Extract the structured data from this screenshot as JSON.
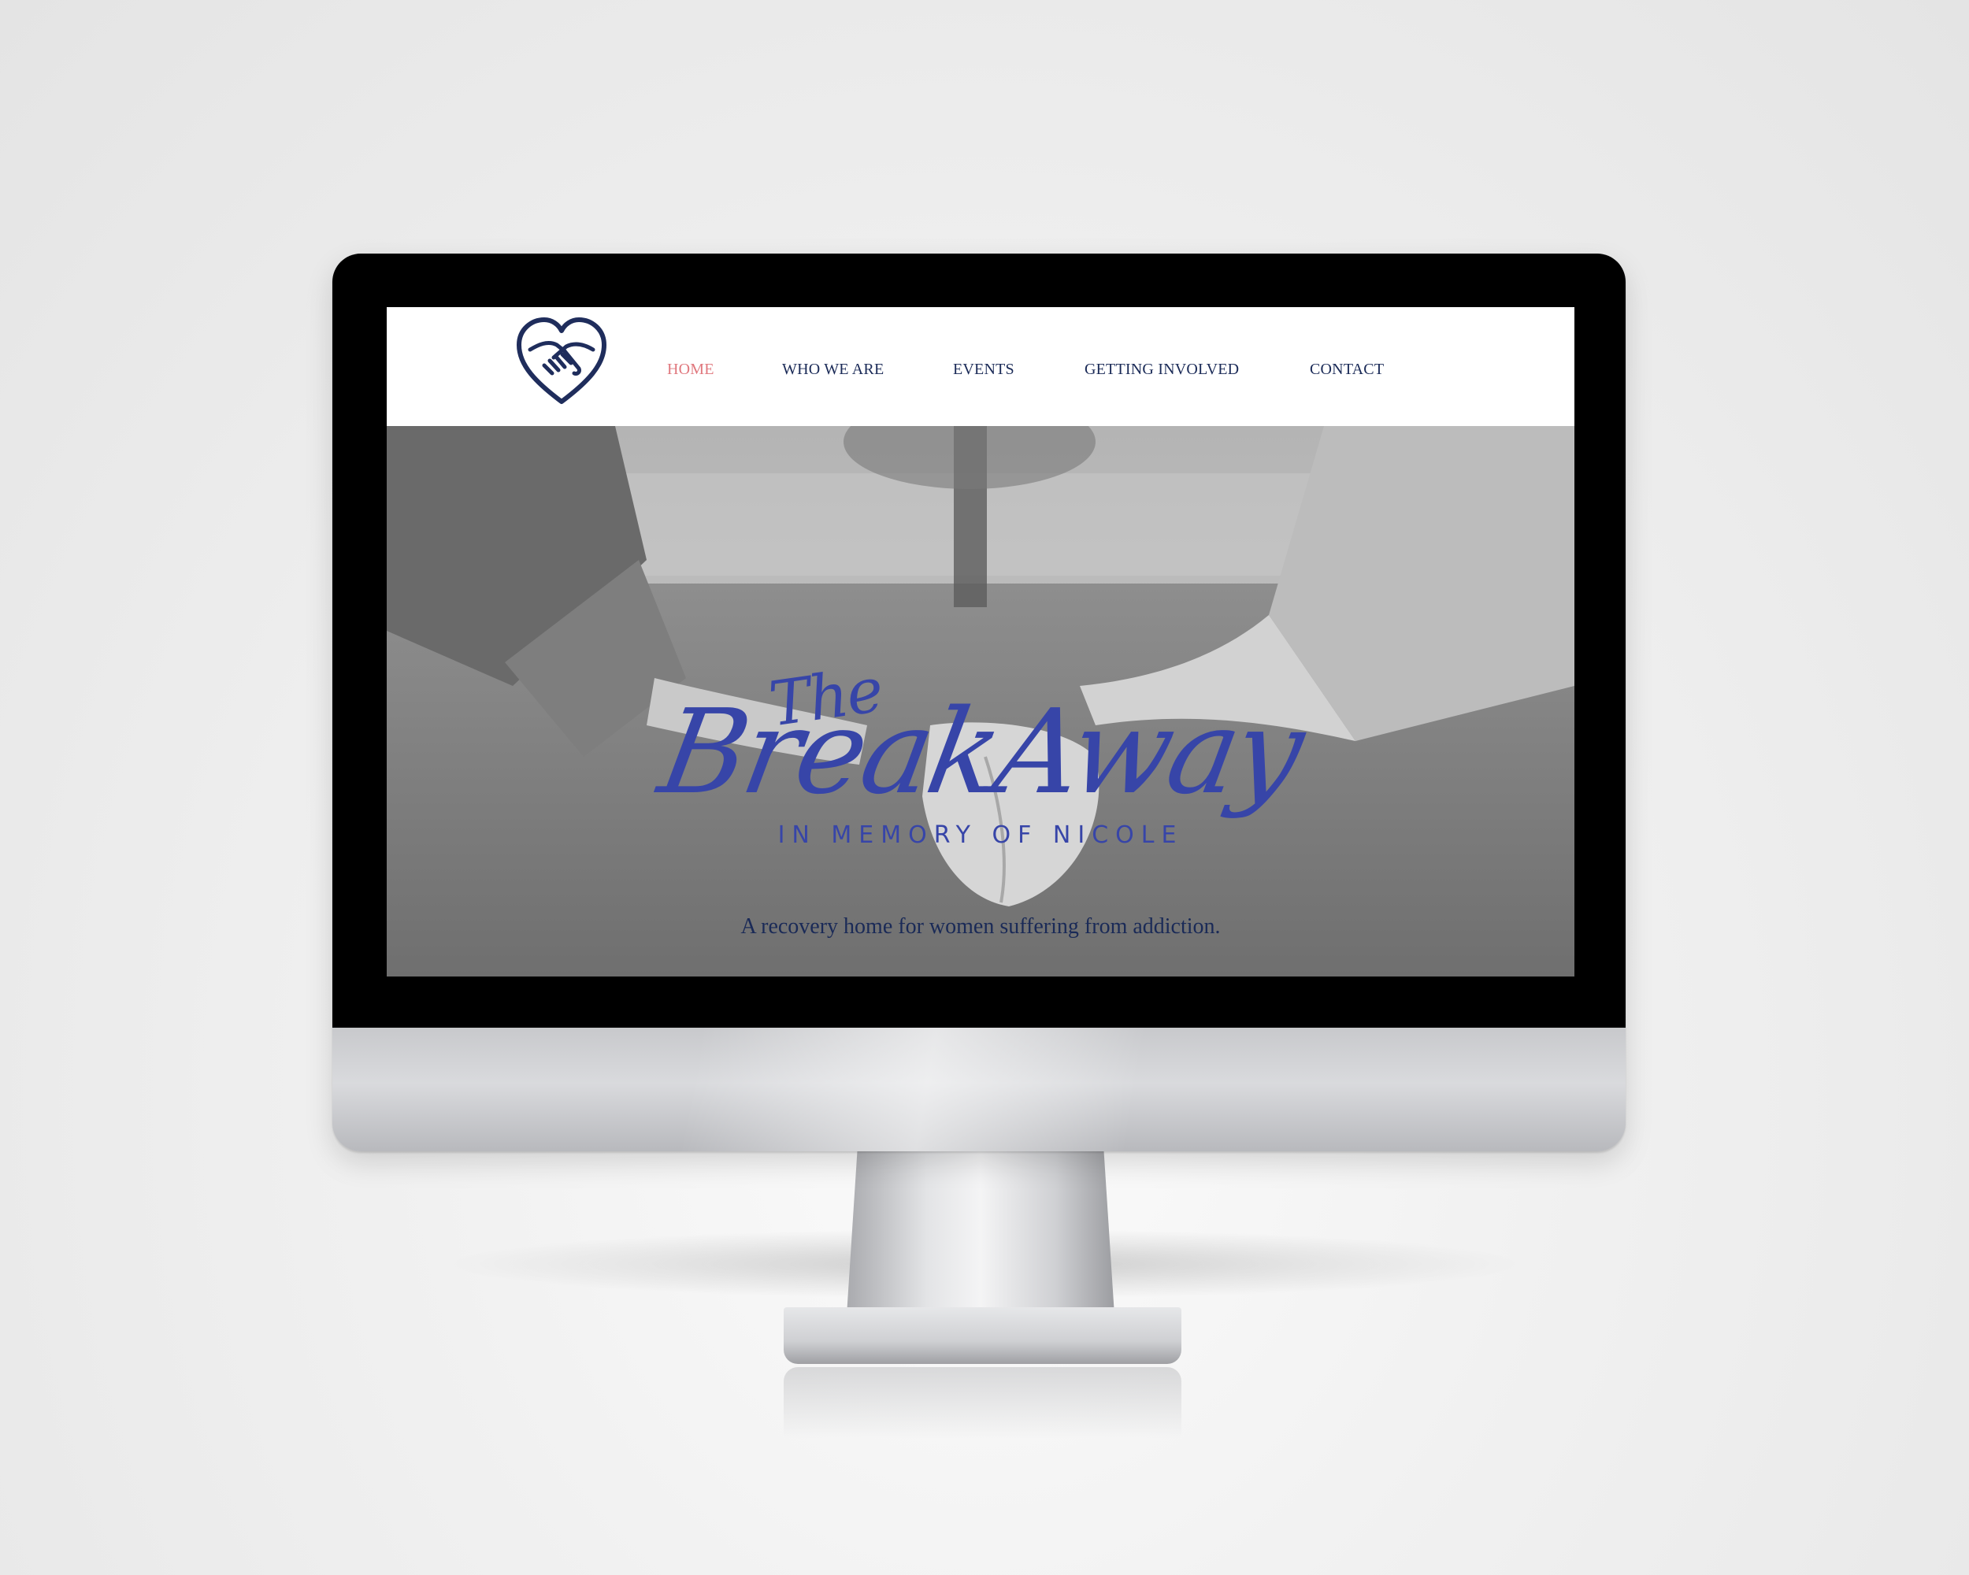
{
  "site": {
    "logo": "heart-handshake-logo",
    "nav": {
      "items": [
        {
          "label": "HOME",
          "active": true
        },
        {
          "label": "WHO WE ARE",
          "active": false
        },
        {
          "label": "EVENTS",
          "active": false
        },
        {
          "label": "GETTING INVOLVED",
          "active": false
        },
        {
          "label": "CONTACT",
          "active": false
        }
      ]
    },
    "hero": {
      "title_prefix": "The",
      "title": "BreakAway",
      "subtitle": "IN MEMORY OF NICOLE",
      "tagline": "A recovery home for women suffering from addiction."
    }
  },
  "colors": {
    "nav_text": "#1a2a57",
    "nav_active": "#e0787e",
    "brand_blue": "#3745a8",
    "logo_navy": "#1f2d5c"
  }
}
